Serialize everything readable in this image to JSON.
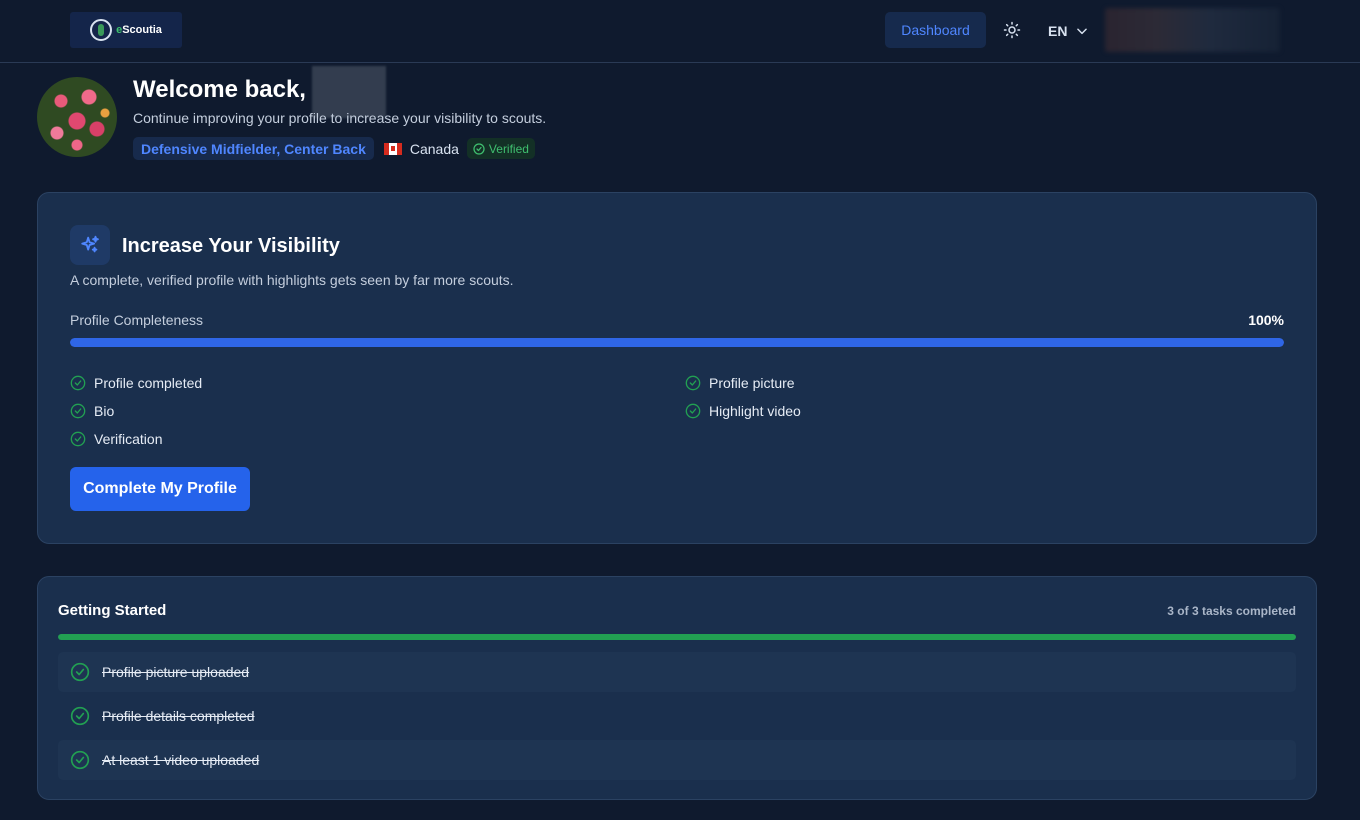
{
  "header": {
    "logo_text": "Scoutia",
    "logo_prefix": "e",
    "dashboard_label": "Dashboard",
    "theme_icon": "sun-icon",
    "language": "EN"
  },
  "welcome": {
    "title": "Welcome back,",
    "subtitle": "Continue improving your profile to increase your visibility to scouts.",
    "position": "Defensive Midfielder, Center Back",
    "country": "Canada",
    "verified": "Verified"
  },
  "visibility_card": {
    "title": "Increase Your Visibility",
    "subtitle": "A complete, verified profile with highlights gets seen by far more scouts.",
    "completeness_label": "Profile Completeness",
    "completeness_value": "100%",
    "completeness_fraction": 1.0,
    "checks_left": [
      "Profile completed",
      "Bio",
      "Verification"
    ],
    "checks_right": [
      "Profile picture",
      "Highlight video"
    ],
    "cta_label": "Complete My Profile"
  },
  "getting_started": {
    "title": "Getting Started",
    "count": "3 of 3 tasks completed",
    "progress_fraction": 1.0,
    "tasks": [
      "Profile picture uploaded",
      "Profile details completed",
      "At least 1 video uploaded"
    ]
  },
  "colors": {
    "accent": "#2563eb",
    "success": "#22a052",
    "background": "#0f1a2e",
    "card": "#1a2f4d"
  }
}
